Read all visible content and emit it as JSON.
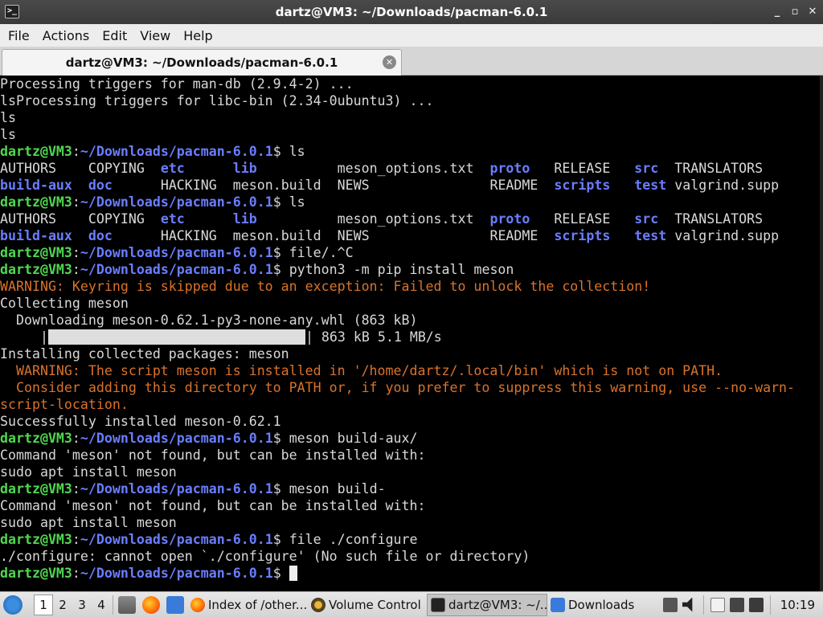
{
  "window": {
    "title": "dartz@VM3: ~/Downloads/pacman-6.0.1",
    "controls": [
      "_",
      "▫",
      "✕"
    ]
  },
  "menu": [
    "File",
    "Actions",
    "Edit",
    "View",
    "Help"
  ],
  "tab": {
    "label": "dartz@VM3: ~/Downloads/pacman-6.0.1",
    "close": "✕"
  },
  "terminal": {
    "prompt_user": "dartz@VM3",
    "prompt_path": "~/Downloads/pacman-6.0.1",
    "lines": [
      {
        "type": "text",
        "text": "Processing triggers for man-db (2.9.4-2) ..."
      },
      {
        "type": "text",
        "text": "lsProcessing triggers for libc-bin (2.34-0ubuntu3) ..."
      },
      {
        "type": "text",
        "text": "ls"
      },
      {
        "type": "text",
        "text": "ls"
      },
      {
        "type": "prompt",
        "cmd": "ls"
      },
      {
        "type": "ls",
        "cells": [
          [
            "AUTHORS",
            ""
          ],
          [
            "COPYING",
            ""
          ],
          [
            "etc",
            "dir"
          ],
          [
            "lib",
            "dir"
          ],
          [
            "meson_options.txt",
            ""
          ],
          [
            "proto",
            "dir"
          ],
          [
            "RELEASE",
            ""
          ],
          [
            "src",
            "dir"
          ],
          [
            "TRANSLATORS",
            ""
          ]
        ]
      },
      {
        "type": "ls",
        "cells": [
          [
            "build-aux",
            "dir"
          ],
          [
            "doc",
            "dir"
          ],
          [
            "HACKING",
            ""
          ],
          [
            "meson.build",
            ""
          ],
          [
            "NEWS",
            ""
          ],
          [
            "README",
            ""
          ],
          [
            "scripts",
            "dir"
          ],
          [
            "test",
            "dir"
          ],
          [
            "valgrind.supp",
            ""
          ]
        ]
      },
      {
        "type": "prompt",
        "cmd": "ls"
      },
      {
        "type": "ls",
        "cells": [
          [
            "AUTHORS",
            ""
          ],
          [
            "COPYING",
            ""
          ],
          [
            "etc",
            "dir"
          ],
          [
            "lib",
            "dir"
          ],
          [
            "meson_options.txt",
            ""
          ],
          [
            "proto",
            "dir"
          ],
          [
            "RELEASE",
            ""
          ],
          [
            "src",
            "dir"
          ],
          [
            "TRANSLATORS",
            ""
          ]
        ]
      },
      {
        "type": "ls",
        "cells": [
          [
            "build-aux",
            "dir"
          ],
          [
            "doc",
            "dir"
          ],
          [
            "HACKING",
            ""
          ],
          [
            "meson.build",
            ""
          ],
          [
            "NEWS",
            ""
          ],
          [
            "README",
            ""
          ],
          [
            "scripts",
            "dir"
          ],
          [
            "test",
            "dir"
          ],
          [
            "valgrind.supp",
            ""
          ]
        ]
      },
      {
        "type": "prompt",
        "cmd": "file/.^C"
      },
      {
        "type": "prompt",
        "cmd": "python3 -m pip install meson"
      },
      {
        "type": "warn",
        "text": "WARNING: Keyring is skipped due to an exception: Failed to unlock the collection!"
      },
      {
        "type": "text",
        "text": "Collecting meson"
      },
      {
        "type": "text",
        "text": "  Downloading meson-0.62.1-py3-none-any.whl (863 kB)"
      },
      {
        "type": "progress",
        "prefix": "     |",
        "suffix": "| 863 kB 5.1 MB/s"
      },
      {
        "type": "text",
        "text": "Installing collected packages: meson"
      },
      {
        "type": "warn",
        "text": "  WARNING: The script meson is installed in '/home/dartz/.local/bin' which is not on PATH."
      },
      {
        "type": "warn",
        "text": "  Consider adding this directory to PATH or, if you prefer to suppress this warning, use --no-warn-"
      },
      {
        "type": "warn",
        "text": "script-location."
      },
      {
        "type": "text",
        "text": "Successfully installed meson-0.62.1"
      },
      {
        "type": "prompt",
        "cmd": "meson build-aux/"
      },
      {
        "type": "text",
        "text": "Command 'meson' not found, but can be installed with:"
      },
      {
        "type": "text",
        "text": "sudo apt install meson"
      },
      {
        "type": "prompt",
        "cmd": "meson build-"
      },
      {
        "type": "text",
        "text": "Command 'meson' not found, but can be installed with:"
      },
      {
        "type": "text",
        "text": "sudo apt install meson"
      },
      {
        "type": "prompt",
        "cmd": "file ./configure"
      },
      {
        "type": "text",
        "text": "./configure: cannot open `./configure' (No such file or directory)"
      },
      {
        "type": "prompt",
        "cmd": "",
        "cursor": true
      }
    ]
  },
  "taskbar": {
    "workspaces": [
      "1",
      "2",
      "3",
      "4"
    ],
    "active_workspace": "1",
    "tasks": [
      {
        "label": "Index of /other...",
        "icon": "firefox-icon"
      },
      {
        "label": "Volume Control",
        "icon": "volume-control-icon"
      },
      {
        "label": "dartz@VM3: ~/...",
        "icon": "terminal-icon",
        "active": true
      },
      {
        "label": "Downloads",
        "icon": "folder-icon"
      }
    ],
    "clock": "10:19"
  }
}
